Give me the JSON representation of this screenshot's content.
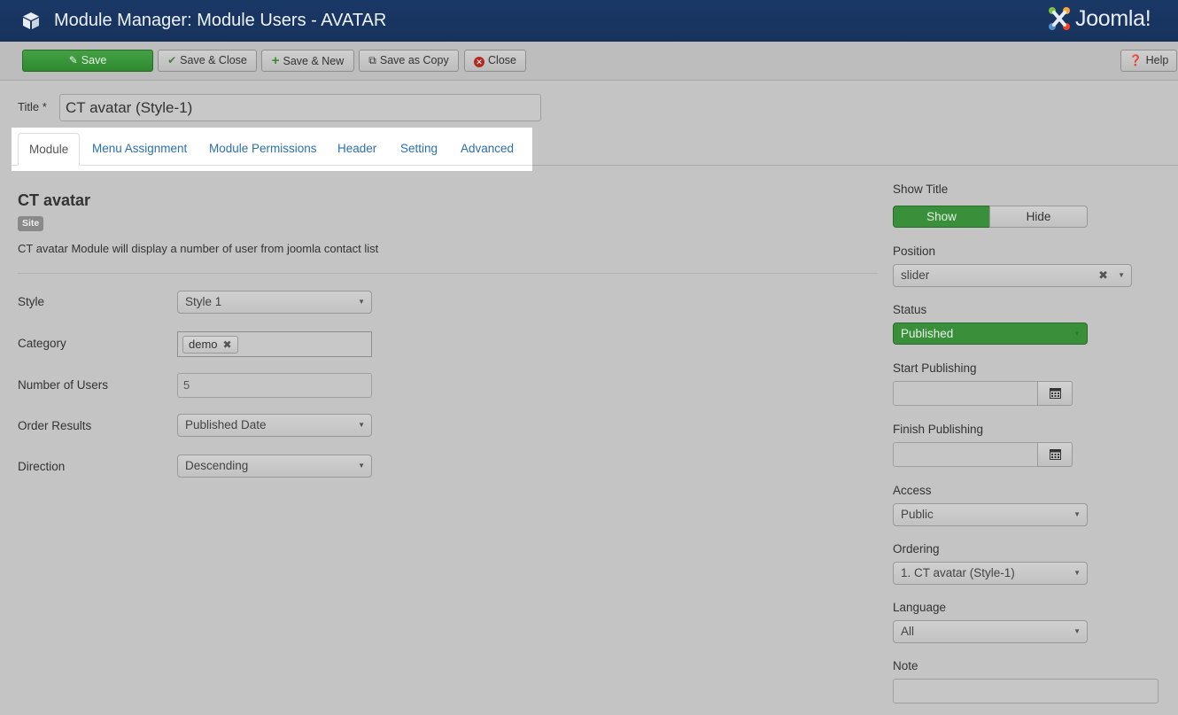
{
  "header": {
    "title": "Module Manager: Module Users - AVATAR",
    "brand": "Joomla!",
    "module_icon": "cube-icon",
    "colors": {
      "bar": "#17325c"
    }
  },
  "toolbar": {
    "save": "Save",
    "save_close": "Save & Close",
    "save_new": "Save & New",
    "save_copy": "Save as Copy",
    "close": "Close",
    "help": "Help",
    "colors": {
      "save": "#3a8f3a",
      "close_icon": "#b22a22"
    }
  },
  "title_field": {
    "label": "Title *",
    "value": "CT avatar (Style-1)"
  },
  "tabs": [
    {
      "label": "Module",
      "active": true
    },
    {
      "label": "Menu Assignment",
      "active": false
    },
    {
      "label": "Module Permissions",
      "active": false
    },
    {
      "label": "Header",
      "active": false
    },
    {
      "label": "Setting",
      "active": false
    },
    {
      "label": "Advanced",
      "active": false
    }
  ],
  "module": {
    "name": "CT avatar",
    "badge": "Site",
    "description": "CT avatar Module will display a number of user from joomla contact list"
  },
  "fields": {
    "style": {
      "label": "Style",
      "value": "Style 1"
    },
    "category": {
      "label": "Category",
      "tag": "demo"
    },
    "num_users": {
      "label": "Number of Users",
      "value": "5"
    },
    "order_results": {
      "label": "Order Results",
      "value": "Published Date"
    },
    "direction": {
      "label": "Direction",
      "value": "Descending"
    }
  },
  "sidebar": {
    "show_title": {
      "label": "Show Title",
      "show": "Show",
      "hide": "Hide",
      "selected": "Show"
    },
    "position": {
      "label": "Position",
      "value": "slider"
    },
    "status": {
      "label": "Status",
      "value": "Published"
    },
    "start_publishing": {
      "label": "Start Publishing",
      "value": ""
    },
    "finish_publishing": {
      "label": "Finish Publishing",
      "value": ""
    },
    "access": {
      "label": "Access",
      "value": "Public"
    },
    "ordering": {
      "label": "Ordering",
      "value": "1. CT avatar (Style-1)"
    },
    "language": {
      "label": "Language",
      "value": "All"
    },
    "note": {
      "label": "Note",
      "value": ""
    }
  }
}
